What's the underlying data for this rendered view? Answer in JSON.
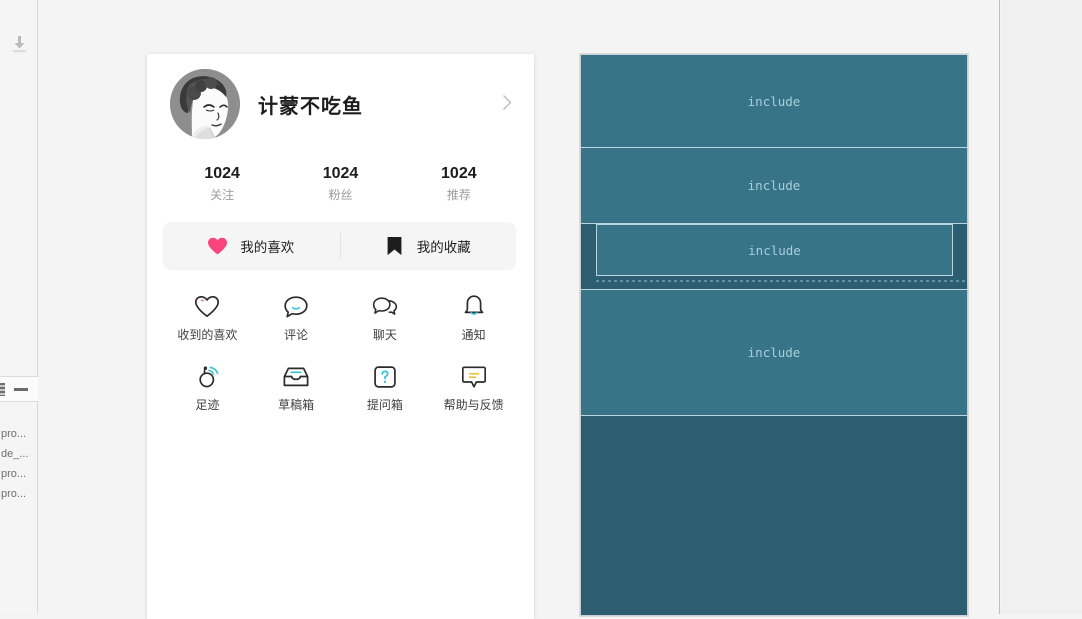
{
  "left_rail": {
    "download_icon": "download-icon",
    "toolbar": {
      "left_icon": "layers-icon",
      "minimize_icon": "minimize-icon"
    },
    "tree_items": [
      "pro...",
      "de_...",
      "pro...",
      "pro..."
    ]
  },
  "phone_preview": {
    "profile": {
      "avatar": "avatar-illustration",
      "name": "计蒙不吃鱼",
      "chevron": "chevron-right-icon"
    },
    "stats": [
      {
        "value": "1024",
        "label": "关注"
      },
      {
        "value": "1024",
        "label": "粉丝"
      },
      {
        "value": "1024",
        "label": "推荐"
      }
    ],
    "fav_bar": [
      {
        "icon": "heart-filled-icon",
        "label": "我的喜欢",
        "color": "#f9447d"
      },
      {
        "icon": "bookmark-filled-icon",
        "label": "我的收藏",
        "color": "#1d1d1d"
      }
    ],
    "grid": [
      {
        "icon": "heart-outline-icon",
        "label": "收到的喜欢"
      },
      {
        "icon": "comment-bubble-icon",
        "label": "评论"
      },
      {
        "icon": "chat-bubbles-icon",
        "label": "聊天"
      },
      {
        "icon": "bell-icon",
        "label": "通知"
      },
      {
        "icon": "footprint-signal-icon",
        "label": "足迹"
      },
      {
        "icon": "inbox-tray-icon",
        "label": "草稿箱"
      },
      {
        "icon": "question-box-icon",
        "label": "提问箱"
      },
      {
        "icon": "feedback-bubble-icon",
        "label": "帮助与反馈"
      }
    ]
  },
  "teal_panel": {
    "blocks": [
      {
        "label": "include"
      },
      {
        "label": "include"
      },
      {
        "label": "include"
      },
      {
        "label": "include"
      },
      {
        "label": ""
      }
    ]
  },
  "colors": {
    "teal_block": "#387488",
    "teal_dark": "#2d5d70",
    "teal_text": "#a9cedb",
    "accent_pink": "#f9447d",
    "page_bg": "#f4f4f4"
  }
}
